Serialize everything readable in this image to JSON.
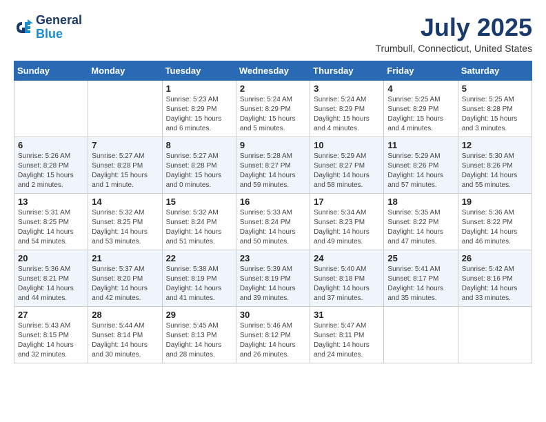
{
  "header": {
    "logo_line1": "General",
    "logo_line2": "Blue",
    "month_year": "July 2025",
    "location": "Trumbull, Connecticut, United States"
  },
  "weekdays": [
    "Sunday",
    "Monday",
    "Tuesday",
    "Wednesday",
    "Thursday",
    "Friday",
    "Saturday"
  ],
  "weeks": [
    [
      {
        "day": "",
        "info": ""
      },
      {
        "day": "",
        "info": ""
      },
      {
        "day": "1",
        "info": "Sunrise: 5:23 AM\nSunset: 8:29 PM\nDaylight: 15 hours and 6 minutes."
      },
      {
        "day": "2",
        "info": "Sunrise: 5:24 AM\nSunset: 8:29 PM\nDaylight: 15 hours and 5 minutes."
      },
      {
        "day": "3",
        "info": "Sunrise: 5:24 AM\nSunset: 8:29 PM\nDaylight: 15 hours and 4 minutes."
      },
      {
        "day": "4",
        "info": "Sunrise: 5:25 AM\nSunset: 8:29 PM\nDaylight: 15 hours and 4 minutes."
      },
      {
        "day": "5",
        "info": "Sunrise: 5:25 AM\nSunset: 8:28 PM\nDaylight: 15 hours and 3 minutes."
      }
    ],
    [
      {
        "day": "6",
        "info": "Sunrise: 5:26 AM\nSunset: 8:28 PM\nDaylight: 15 hours and 2 minutes."
      },
      {
        "day": "7",
        "info": "Sunrise: 5:27 AM\nSunset: 8:28 PM\nDaylight: 15 hours and 1 minute."
      },
      {
        "day": "8",
        "info": "Sunrise: 5:27 AM\nSunset: 8:28 PM\nDaylight: 15 hours and 0 minutes."
      },
      {
        "day": "9",
        "info": "Sunrise: 5:28 AM\nSunset: 8:27 PM\nDaylight: 14 hours and 59 minutes."
      },
      {
        "day": "10",
        "info": "Sunrise: 5:29 AM\nSunset: 8:27 PM\nDaylight: 14 hours and 58 minutes."
      },
      {
        "day": "11",
        "info": "Sunrise: 5:29 AM\nSunset: 8:26 PM\nDaylight: 14 hours and 57 minutes."
      },
      {
        "day": "12",
        "info": "Sunrise: 5:30 AM\nSunset: 8:26 PM\nDaylight: 14 hours and 55 minutes."
      }
    ],
    [
      {
        "day": "13",
        "info": "Sunrise: 5:31 AM\nSunset: 8:25 PM\nDaylight: 14 hours and 54 minutes."
      },
      {
        "day": "14",
        "info": "Sunrise: 5:32 AM\nSunset: 8:25 PM\nDaylight: 14 hours and 53 minutes."
      },
      {
        "day": "15",
        "info": "Sunrise: 5:32 AM\nSunset: 8:24 PM\nDaylight: 14 hours and 51 minutes."
      },
      {
        "day": "16",
        "info": "Sunrise: 5:33 AM\nSunset: 8:24 PM\nDaylight: 14 hours and 50 minutes."
      },
      {
        "day": "17",
        "info": "Sunrise: 5:34 AM\nSunset: 8:23 PM\nDaylight: 14 hours and 49 minutes."
      },
      {
        "day": "18",
        "info": "Sunrise: 5:35 AM\nSunset: 8:22 PM\nDaylight: 14 hours and 47 minutes."
      },
      {
        "day": "19",
        "info": "Sunrise: 5:36 AM\nSunset: 8:22 PM\nDaylight: 14 hours and 46 minutes."
      }
    ],
    [
      {
        "day": "20",
        "info": "Sunrise: 5:36 AM\nSunset: 8:21 PM\nDaylight: 14 hours and 44 minutes."
      },
      {
        "day": "21",
        "info": "Sunrise: 5:37 AM\nSunset: 8:20 PM\nDaylight: 14 hours and 42 minutes."
      },
      {
        "day": "22",
        "info": "Sunrise: 5:38 AM\nSunset: 8:19 PM\nDaylight: 14 hours and 41 minutes."
      },
      {
        "day": "23",
        "info": "Sunrise: 5:39 AM\nSunset: 8:19 PM\nDaylight: 14 hours and 39 minutes."
      },
      {
        "day": "24",
        "info": "Sunrise: 5:40 AM\nSunset: 8:18 PM\nDaylight: 14 hours and 37 minutes."
      },
      {
        "day": "25",
        "info": "Sunrise: 5:41 AM\nSunset: 8:17 PM\nDaylight: 14 hours and 35 minutes."
      },
      {
        "day": "26",
        "info": "Sunrise: 5:42 AM\nSunset: 8:16 PM\nDaylight: 14 hours and 33 minutes."
      }
    ],
    [
      {
        "day": "27",
        "info": "Sunrise: 5:43 AM\nSunset: 8:15 PM\nDaylight: 14 hours and 32 minutes."
      },
      {
        "day": "28",
        "info": "Sunrise: 5:44 AM\nSunset: 8:14 PM\nDaylight: 14 hours and 30 minutes."
      },
      {
        "day": "29",
        "info": "Sunrise: 5:45 AM\nSunset: 8:13 PM\nDaylight: 14 hours and 28 minutes."
      },
      {
        "day": "30",
        "info": "Sunrise: 5:46 AM\nSunset: 8:12 PM\nDaylight: 14 hours and 26 minutes."
      },
      {
        "day": "31",
        "info": "Sunrise: 5:47 AM\nSunset: 8:11 PM\nDaylight: 14 hours and 24 minutes."
      },
      {
        "day": "",
        "info": ""
      },
      {
        "day": "",
        "info": ""
      }
    ]
  ]
}
